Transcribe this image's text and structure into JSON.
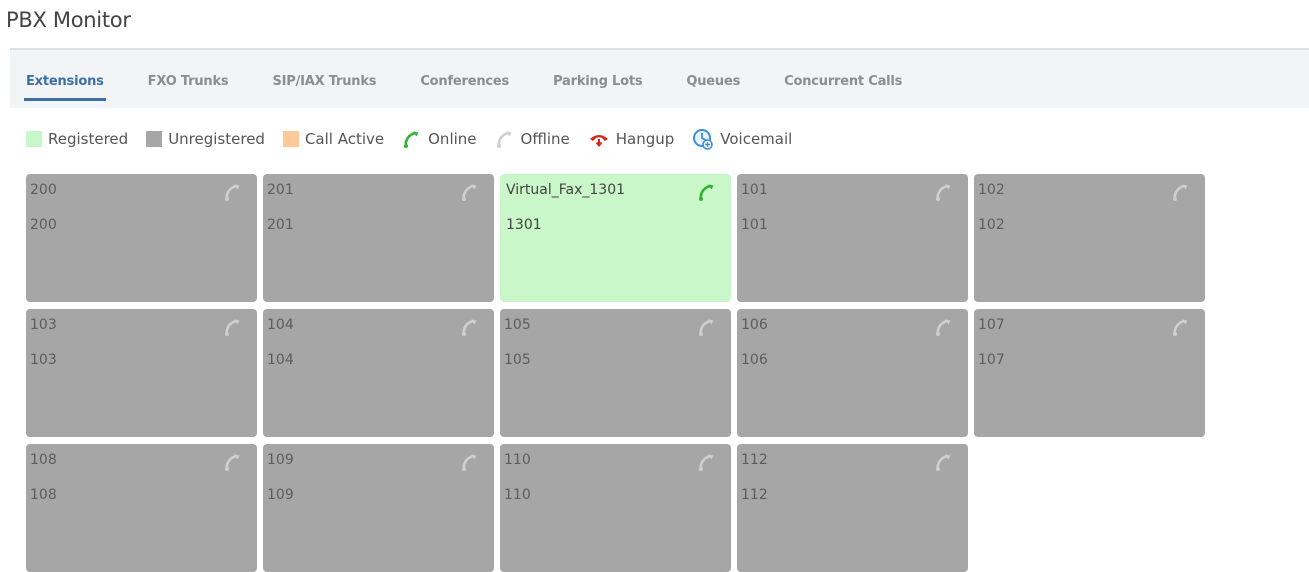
{
  "page": {
    "title": "PBX Monitor"
  },
  "tabs": [
    {
      "label": "Extensions",
      "active": true
    },
    {
      "label": "FXO Trunks",
      "active": false
    },
    {
      "label": "SIP/IAX Trunks",
      "active": false
    },
    {
      "label": "Conferences",
      "active": false
    },
    {
      "label": "Parking Lots",
      "active": false
    },
    {
      "label": "Queues",
      "active": false
    },
    {
      "label": "Concurrent Calls",
      "active": false
    }
  ],
  "legend": {
    "registered": "Registered",
    "unregistered": "Unregistered",
    "call_active": "Call Active",
    "online": "Online",
    "offline": "Offline",
    "hangup": "Hangup",
    "voicemail": "Voicemail"
  },
  "colors": {
    "registered": "#c9f7c9",
    "unregistered": "#a6a6a6",
    "call_active": "#ffc899",
    "online": "#34b233",
    "offline": "#cfcfcf",
    "hangup": "#d9261c",
    "voicemail": "#3b8fd6",
    "accent": "#3a6fa8"
  },
  "extensions": [
    {
      "name": "200",
      "number": "200",
      "status": "unregistered",
      "phone": "offline"
    },
    {
      "name": "201",
      "number": "201",
      "status": "unregistered",
      "phone": "offline"
    },
    {
      "name": "Virtual_Fax_1301",
      "number": "1301",
      "status": "registered",
      "phone": "online"
    },
    {
      "name": "101",
      "number": "101",
      "status": "unregistered",
      "phone": "offline"
    },
    {
      "name": "102",
      "number": "102",
      "status": "unregistered",
      "phone": "offline"
    },
    {
      "name": "103",
      "number": "103",
      "status": "unregistered",
      "phone": "offline"
    },
    {
      "name": "104",
      "number": "104",
      "status": "unregistered",
      "phone": "offline"
    },
    {
      "name": "105",
      "number": "105",
      "status": "unregistered",
      "phone": "offline"
    },
    {
      "name": "106",
      "number": "106",
      "status": "unregistered",
      "phone": "offline"
    },
    {
      "name": "107",
      "number": "107",
      "status": "unregistered",
      "phone": "offline"
    },
    {
      "name": "108",
      "number": "108",
      "status": "unregistered",
      "phone": "offline"
    },
    {
      "name": "109",
      "number": "109",
      "status": "unregistered",
      "phone": "offline"
    },
    {
      "name": "110",
      "number": "110",
      "status": "unregistered",
      "phone": "offline"
    },
    {
      "name": "112",
      "number": "112",
      "status": "unregistered",
      "phone": "offline"
    }
  ]
}
